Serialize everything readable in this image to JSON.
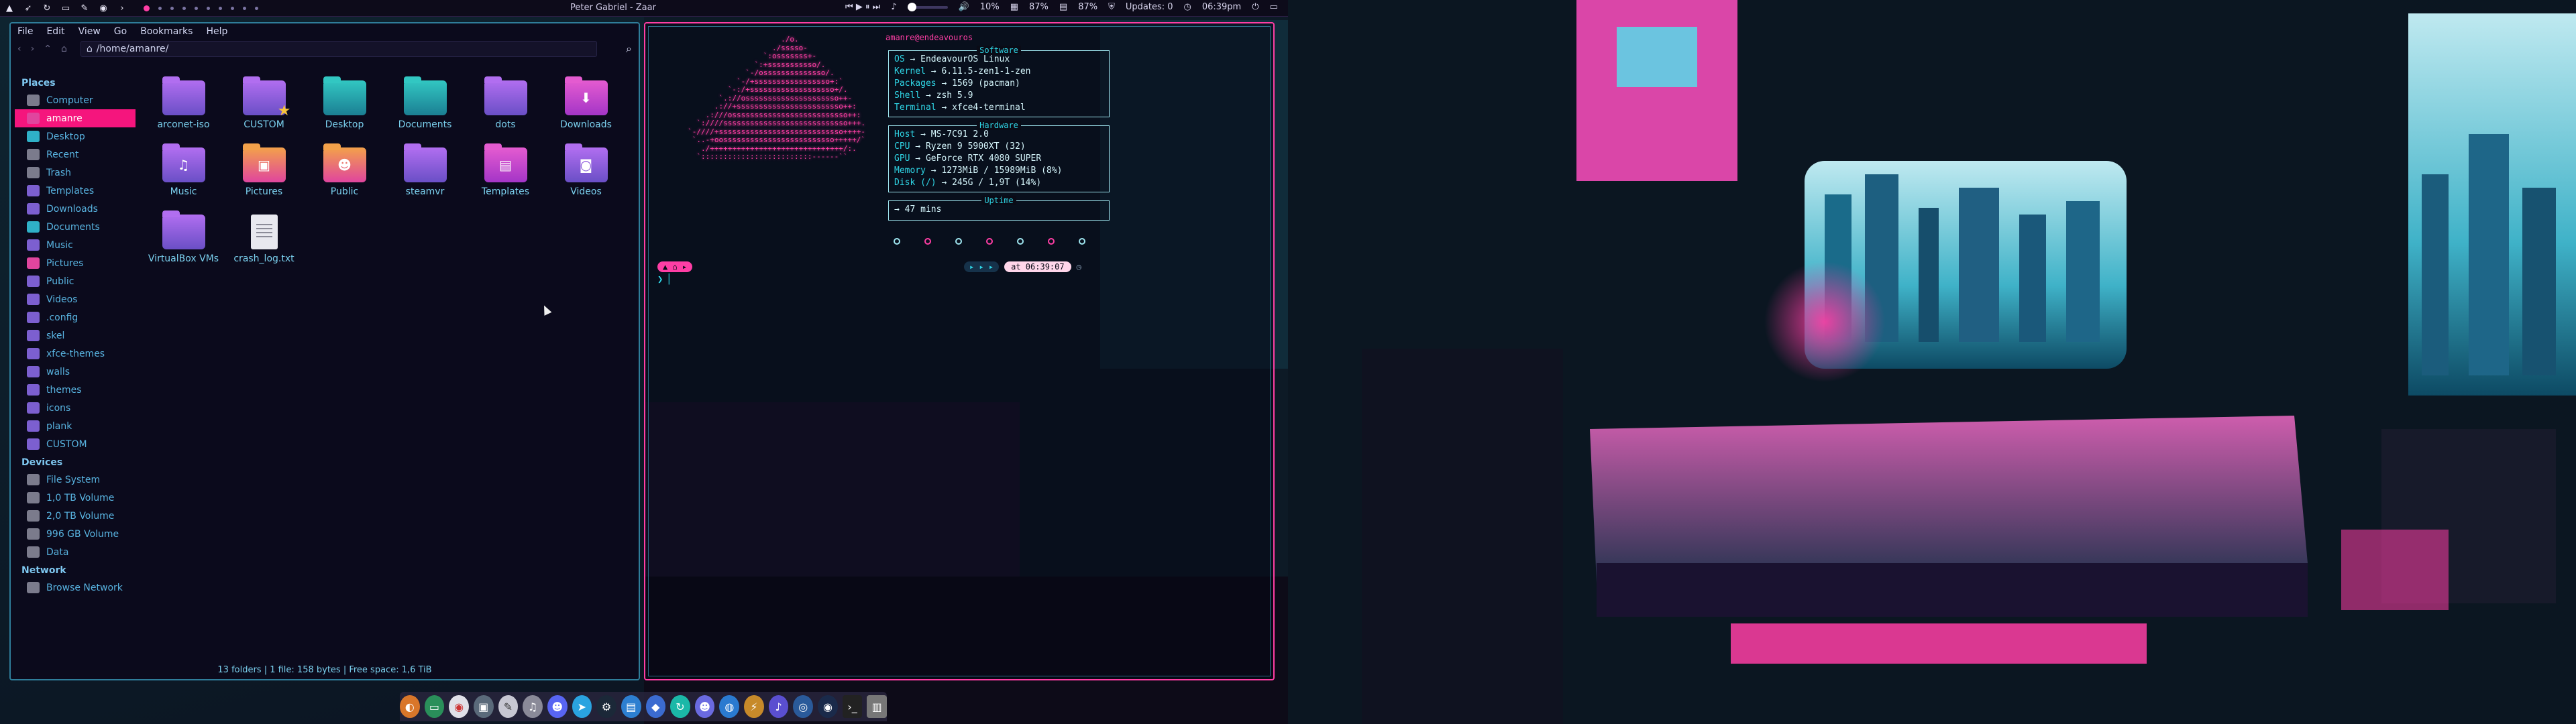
{
  "topbar": {
    "window_title": "Peter Gabriel - Zaar",
    "media_icons": [
      "previous-icon",
      "play-icon",
      "pause-icon",
      "next-icon"
    ],
    "volume_percent": 10,
    "volume_label": "10%",
    "cpu_label": "87%",
    "ram_label": "87%",
    "updates_label": "Updates: 0",
    "clock": "06:39pm"
  },
  "file_manager": {
    "menu": [
      "File",
      "Edit",
      "View",
      "Go",
      "Bookmarks",
      "Help"
    ],
    "path": "/home/amanre/",
    "sidebar": {
      "places_header": "Places",
      "places": [
        "Computer",
        "amanre",
        "Desktop",
        "Recent",
        "Trash",
        "Templates",
        "Downloads",
        "Documents",
        "Music",
        "Pictures",
        "Public",
        "Videos",
        ".config",
        "skel",
        "xfce-themes",
        "walls",
        "themes",
        "icons",
        "plank",
        "CUSTOM"
      ],
      "devices_header": "Devices",
      "devices": [
        "File System",
        "1,0 TB Volume",
        "2,0 TB Volume",
        "996 GB Volume",
        "Data"
      ],
      "network_header": "Network",
      "network": [
        "Browse Network"
      ]
    },
    "items": [
      "arconet-iso",
      "CUSTOM",
      "Desktop",
      "Documents",
      "dots",
      "Downloads",
      "Music",
      "Pictures",
      "Public",
      "steamvr",
      "Templates",
      "Videos",
      "VirtualBox VMs",
      "crash_log.txt"
    ],
    "status": "13 folders  |  1 file: 158 bytes  |  Free space: 1,6 TiB"
  },
  "terminal": {
    "user_host": "amanre@endeavouros",
    "software_header": "Software",
    "os_key": "OS",
    "os_val": "EndeavourOS Linux",
    "kernel_key": "Kernel",
    "kernel_val": "6.11.5-zen1-1-zen",
    "packages_key": "Packages",
    "packages_val": "1569 (pacman)",
    "shell_key": "Shell",
    "shell_val": "zsh 5.9",
    "terminal_key": "Terminal",
    "terminal_val": "xfce4-terminal",
    "hardware_header": "Hardware",
    "host_key": "Host",
    "host_val": "MS-7C91 2.0",
    "cpu_key": "CPU",
    "cpu_val": "Ryzen 9 5900XT (32)",
    "gpu_key": "GPU",
    "gpu_val": "GeForce RTX 4080 SUPER",
    "memory_key": "Memory",
    "memory_val": "1273MiB / 15989MiB (8%)",
    "disk_key": "Disk (/)",
    "disk_val": "245G / 1,9T (14%)",
    "uptime_header": "Uptime",
    "uptime_val": "47 mins",
    "prompt_time": "at 06:39:07",
    "prompt_caret": "❯"
  }
}
